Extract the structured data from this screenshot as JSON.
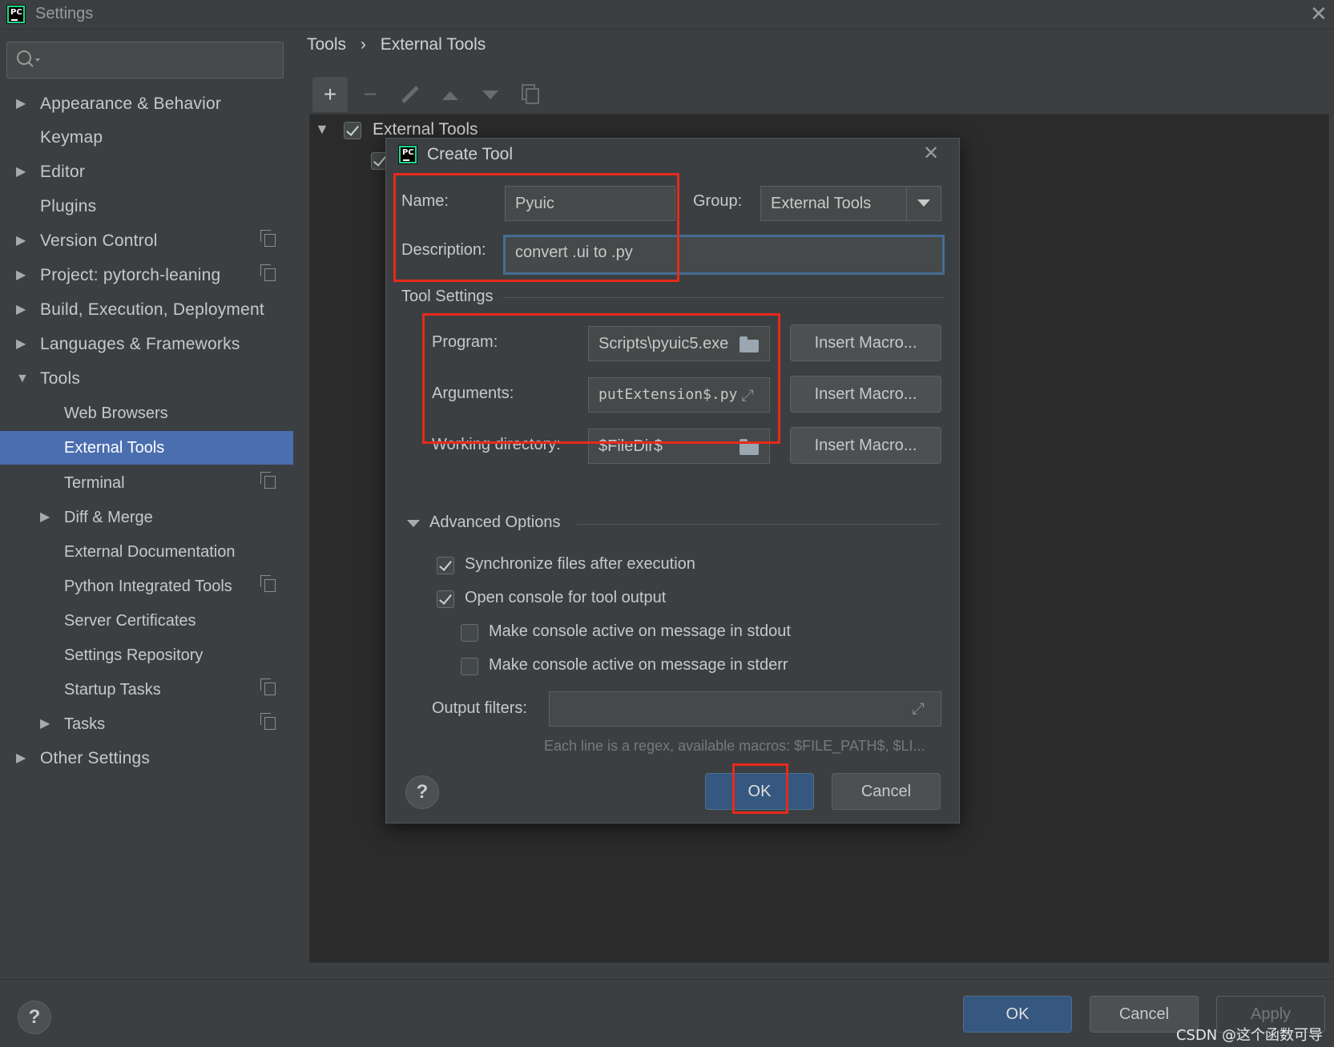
{
  "window": {
    "title": "Settings"
  },
  "search": {
    "placeholder": ""
  },
  "sidebar": {
    "items": [
      {
        "label": "Appearance & Behavior"
      },
      {
        "label": "Keymap"
      },
      {
        "label": "Editor"
      },
      {
        "label": "Plugins"
      },
      {
        "label": "Version Control"
      },
      {
        "label": "Project: pytorch-leaning"
      },
      {
        "label": "Build, Execution, Deployment"
      },
      {
        "label": "Languages & Frameworks"
      },
      {
        "label": "Tools"
      },
      {
        "label": "Web Browsers"
      },
      {
        "label": "External Tools"
      },
      {
        "label": "Terminal"
      },
      {
        "label": "Diff & Merge"
      },
      {
        "label": "External Documentation"
      },
      {
        "label": "Python Integrated Tools"
      },
      {
        "label": "Server Certificates"
      },
      {
        "label": "Settings Repository"
      },
      {
        "label": "Startup Tasks"
      },
      {
        "label": "Tasks"
      },
      {
        "label": "Other Settings"
      }
    ]
  },
  "breadcrumb": {
    "root": "Tools",
    "separator": "›",
    "current": "External Tools"
  },
  "toolbar": {
    "add": "+",
    "remove": "−"
  },
  "tree": {
    "root_label": "External Tools"
  },
  "dialog": {
    "title": "Create Tool",
    "name_label": "Name:",
    "name_value": "Pyuic",
    "group_label": "Group:",
    "group_value": "External Tools",
    "description_label": "Description:",
    "description_value": "convert .ui to .py",
    "tool_settings_title": "Tool Settings",
    "program_label": "Program:",
    "program_value": "Scripts\\pyuic5.exe",
    "arguments_label": "Arguments:",
    "arguments_value": "putExtension$.py",
    "workdir_label": "Working directory:",
    "workdir_value": "$FileDir$",
    "insert_macro_label": "Insert Macro...",
    "advanced_title": "Advanced Options",
    "sync_label": "Synchronize files after execution",
    "sync_checked": true,
    "open_console_label": "Open console for tool output",
    "open_console_checked": true,
    "stdout_label": "Make console active on message in stdout",
    "stdout_checked": false,
    "stderr_label": "Make console active on message in stderr",
    "stderr_checked": false,
    "output_filters_label": "Output filters:",
    "output_filters_value": "",
    "hint": "Each line is a regex, available macros: $FILE_PATH$, $LI...",
    "ok_label": "OK",
    "cancel_label": "Cancel",
    "help_label": "?"
  },
  "footer": {
    "help_label": "?",
    "ok_label": "OK",
    "cancel_label": "Cancel",
    "apply_label": "Apply"
  },
  "watermark": "CSDN @这个函数可导",
  "colors": {
    "accent": "#4b6eaf",
    "highlight": "#e8291c",
    "primary_button": "#365880"
  }
}
